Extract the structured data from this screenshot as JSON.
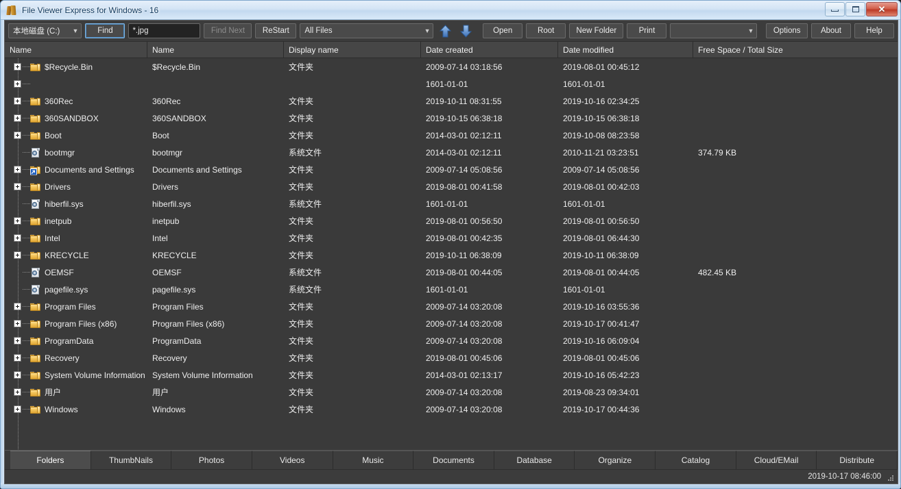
{
  "window": {
    "title": "File Viewer Express for Windows - 16",
    "app_icon": "books-icon",
    "controls": {
      "minimize": "minimize-icon",
      "maximize": "maximize-icon",
      "close": "close-icon"
    }
  },
  "toolbar": {
    "drive_select": {
      "value": "本地磁盘 (C:)",
      "caret": "▼"
    },
    "find_button": "Find",
    "search_input": {
      "value": "*.jpg",
      "placeholder": ""
    },
    "find_next_button": "Find Next",
    "restart_button": "ReStart",
    "filter_select": {
      "value": "All Files",
      "caret": "▼"
    },
    "up_arrow": "arrow-up-icon",
    "down_arrow": "arrow-down-icon",
    "open_button": "Open",
    "root_button": "Root",
    "new_folder_button": "New Folder",
    "print_button": "Print",
    "blank_select": {
      "value": "",
      "caret": "▼"
    },
    "options_button": "Options",
    "about_button": "About",
    "help_button": "Help"
  },
  "columns": [
    "Name",
    "Name",
    "Display name",
    "Date created",
    "Date modified",
    "Free Space / Total Size"
  ],
  "rows": [
    {
      "name": "$Recycle.Bin",
      "name2": "$Recycle.Bin",
      "display": "文件夹",
      "created": "2009-07-14 03:18:56",
      "modified": "2019-08-01 00:45:12",
      "size": "",
      "icon": "folder-icon",
      "expander": true
    },
    {
      "name": "",
      "name2": "",
      "display": "",
      "created": "1601-01-01",
      "modified": "1601-01-01",
      "size": "",
      "icon": "none",
      "expander": true
    },
    {
      "name": "360Rec",
      "name2": "360Rec",
      "display": "文件夹",
      "created": "2019-10-11 08:31:55",
      "modified": "2019-10-16 02:34:25",
      "size": "",
      "icon": "folder-icon",
      "expander": true
    },
    {
      "name": "360SANDBOX",
      "name2": "360SANDBOX",
      "display": "文件夹",
      "created": "2019-10-15 06:38:18",
      "modified": "2019-10-15 06:38:18",
      "size": "",
      "icon": "folder-icon",
      "expander": true
    },
    {
      "name": "Boot",
      "name2": "Boot",
      "display": "文件夹",
      "created": "2014-03-01 02:12:11",
      "modified": "2019-10-08 08:23:58",
      "size": "",
      "icon": "folder-icon",
      "expander": true
    },
    {
      "name": "bootmgr",
      "name2": "bootmgr",
      "display": "系统文件",
      "created": "2014-03-01 02:12:11",
      "modified": "2010-11-21 03:23:51",
      "size": "374.79 KB",
      "icon": "system-file-icon",
      "expander": false
    },
    {
      "name": "Documents and Settings",
      "name2": "Documents and Settings",
      "display": "文件夹",
      "created": "2009-07-14 05:08:56",
      "modified": "2009-07-14 05:08:56",
      "size": "",
      "icon": "folder-shortcut-icon",
      "expander": true
    },
    {
      "name": "Drivers",
      "name2": "Drivers",
      "display": "文件夹",
      "created": "2019-08-01 00:41:58",
      "modified": "2019-08-01 00:42:03",
      "size": "",
      "icon": "folder-icon",
      "expander": true
    },
    {
      "name": "hiberfil.sys",
      "name2": "hiberfil.sys",
      "display": "系统文件",
      "created": "1601-01-01",
      "modified": "1601-01-01",
      "size": "",
      "icon": "system-file-icon",
      "expander": false
    },
    {
      "name": "inetpub",
      "name2": "inetpub",
      "display": "文件夹",
      "created": "2019-08-01 00:56:50",
      "modified": "2019-08-01 00:56:50",
      "size": "",
      "icon": "folder-icon",
      "expander": true
    },
    {
      "name": "Intel",
      "name2": "Intel",
      "display": "文件夹",
      "created": "2019-08-01 00:42:35",
      "modified": "2019-08-01 06:44:30",
      "size": "",
      "icon": "folder-icon",
      "expander": true
    },
    {
      "name": "KRECYCLE",
      "name2": "KRECYCLE",
      "display": "文件夹",
      "created": "2019-10-11 06:38:09",
      "modified": "2019-10-11 06:38:09",
      "size": "",
      "icon": "folder-icon",
      "expander": true
    },
    {
      "name": "OEMSF",
      "name2": "OEMSF",
      "display": "系统文件",
      "created": "2019-08-01 00:44:05",
      "modified": "2019-08-01 00:44:05",
      "size": "482.45 KB",
      "icon": "system-file-icon",
      "expander": false
    },
    {
      "name": "pagefile.sys",
      "name2": "pagefile.sys",
      "display": "系统文件",
      "created": "1601-01-01",
      "modified": "1601-01-01",
      "size": "",
      "icon": "system-file-icon",
      "expander": false
    },
    {
      "name": "Program Files",
      "name2": "Program Files",
      "display": "文件夹",
      "created": "2009-07-14 03:20:08",
      "modified": "2019-10-16 03:55:36",
      "size": "",
      "icon": "folder-icon",
      "expander": true
    },
    {
      "name": "Program Files (x86)",
      "name2": "Program Files (x86)",
      "display": "文件夹",
      "created": "2009-07-14 03:20:08",
      "modified": "2019-10-17 00:41:47",
      "size": "",
      "icon": "folder-icon",
      "expander": true
    },
    {
      "name": "ProgramData",
      "name2": "ProgramData",
      "display": "文件夹",
      "created": "2009-07-14 03:20:08",
      "modified": "2019-10-16 06:09:04",
      "size": "",
      "icon": "folder-icon",
      "expander": true
    },
    {
      "name": "Recovery",
      "name2": "Recovery",
      "display": "文件夹",
      "created": "2019-08-01 00:45:06",
      "modified": "2019-08-01 00:45:06",
      "size": "",
      "icon": "folder-icon",
      "expander": true
    },
    {
      "name": "System Volume Information",
      "name2": "System Volume Information",
      "display": "文件夹",
      "created": "2014-03-01 02:13:17",
      "modified": "2019-10-16 05:42:23",
      "size": "",
      "icon": "folder-icon",
      "expander": true
    },
    {
      "name": "用户",
      "name2": "用户",
      "display": "文件夹",
      "created": "2009-07-14 03:20:08",
      "modified": "2019-08-23 09:34:01",
      "size": "",
      "icon": "folder-icon",
      "expander": true
    },
    {
      "name": "Windows",
      "name2": "Windows",
      "display": "文件夹",
      "created": "2009-07-14 03:20:08",
      "modified": "2019-10-17 00:44:36",
      "size": "",
      "icon": "folder-icon",
      "expander": true
    }
  ],
  "tabs": [
    {
      "label": "Folders",
      "active": true
    },
    {
      "label": "ThumbNails",
      "active": false
    },
    {
      "label": "Photos",
      "active": false
    },
    {
      "label": "Videos",
      "active": false
    },
    {
      "label": "Music",
      "active": false
    },
    {
      "label": "Documents",
      "active": false
    },
    {
      "label": "Database",
      "active": false
    },
    {
      "label": "Organize",
      "active": false
    },
    {
      "label": "Catalog",
      "active": false
    },
    {
      "label": "Cloud/EMail",
      "active": false
    },
    {
      "label": "Distribute",
      "active": false
    }
  ],
  "statusbar": {
    "timestamp": "2019-10-17 08:46:00",
    "grip": "resize-grip-icon"
  },
  "colors": {
    "client_bg": "#3a3a3a",
    "toolbar_bg": "#3c3c3c",
    "header_bg": "#464646",
    "text": "#eeeeee",
    "frame": "#bcd4ec",
    "folder_yellow": "#f5c860",
    "arrow_blue": "#5b90d8"
  }
}
